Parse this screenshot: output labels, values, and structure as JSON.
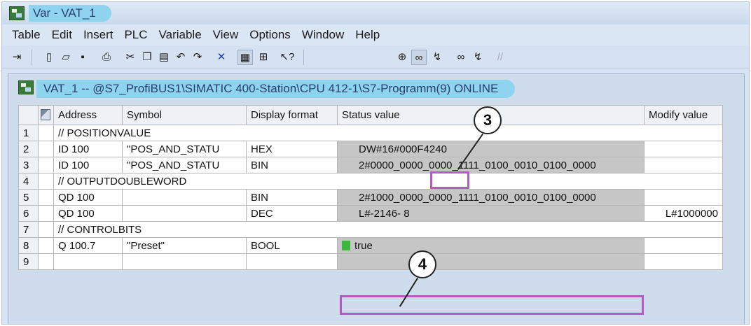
{
  "window": {
    "title": "Var - VAT_1"
  },
  "menu": [
    "Table",
    "Edit",
    "Insert",
    "PLC",
    "Variable",
    "View",
    "Options",
    "Window",
    "Help"
  ],
  "toolbar_icons": [
    "pin-icon",
    "new-icon",
    "open-icon",
    "save-icon",
    "print-icon",
    "cut-icon",
    "copy-icon",
    "paste-icon",
    "undo-icon",
    "redo-icon",
    "delete-icon",
    "monitor-icon",
    "network-icon",
    "help-icon",
    "trigger-icon",
    "monitor-variable-icon",
    "modify-variable-icon",
    "update-icon",
    "activate-icon",
    "force-icon"
  ],
  "child_window": {
    "title": "VAT_1 -- @S7_ProfiBUS1\\SIMATIC 400-Station\\CPU 412-1\\S7-Programm(9)  ONLINE"
  },
  "table": {
    "headers": [
      "Address",
      "Symbol",
      "Display format",
      "Status value",
      "Modify value"
    ],
    "rows": [
      {
        "num": "1",
        "comment": "// POSITIONVALUE"
      },
      {
        "num": "2",
        "address": "ID   100",
        "symbol": "\"POS_AND_STATU",
        "format": "HEX",
        "status": "DW#16#000F4240",
        "modify": ""
      },
      {
        "num": "3",
        "address": "ID   100",
        "symbol": "\"POS_AND_STATU",
        "format": "BIN",
        "status": "2#0000_0000_0000_1111_0100_0010_0100_0000",
        "modify": ""
      },
      {
        "num": "4",
        "comment": "// OUTPUTDOUBLEWORD"
      },
      {
        "num": "5",
        "address": "QD   100",
        "symbol": "",
        "format": "BIN",
        "status": "2#1000_0000_0000_1111_0100_0010_0100_0000",
        "modify": ""
      },
      {
        "num": "6",
        "address": "QD   100",
        "symbol": "",
        "format": "DEC",
        "status": "L#-2146-     8",
        "modify": "L#1000000"
      },
      {
        "num": "7",
        "comment": "// CONTROLBITS"
      },
      {
        "num": "8",
        "address": "Q    100.7",
        "symbol": "\"Preset\"",
        "format": "BOOL",
        "status": "true",
        "modify": ""
      },
      {
        "num": "9"
      }
    ]
  },
  "callouts": [
    {
      "label": "3"
    },
    {
      "label": "4"
    }
  ],
  "colors": {
    "accent_pill": "#8fd4ef",
    "highlight": "#b25bc4",
    "status_gray": "#c6c6c6",
    "true_green": "#3fb43f"
  }
}
